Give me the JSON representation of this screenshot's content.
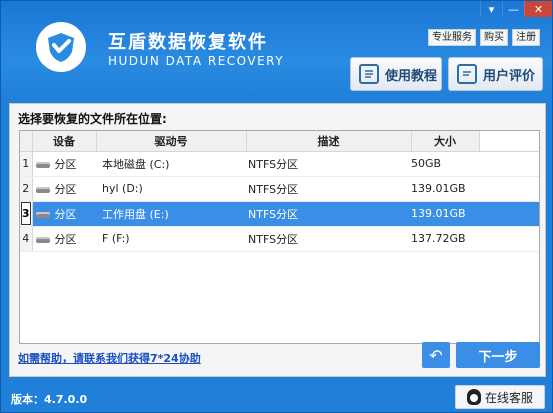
{
  "window": {
    "controls": {
      "minimize": "▾",
      "restore": "—",
      "close": "✕"
    }
  },
  "app": {
    "title": "互盾数据恢复软件",
    "subtitle": "HUDUN DATA RECOVERY",
    "logo_icon": "shield-check-icon",
    "accent": "#1f7bd6"
  },
  "top_links": [
    "专业服务",
    "购买",
    "注册"
  ],
  "buttons": {
    "tutorial": "使用教程",
    "review": "用户评价",
    "next": "下一步",
    "back_icon": "↶"
  },
  "panel": {
    "heading": "选择要恢复的文件所在位置:",
    "columns": [
      "设备",
      "驱动号",
      "描述",
      "大小"
    ],
    "rows": [
      {
        "num": "1",
        "device": "分区",
        "drive": "本地磁盘 (C:)",
        "desc": "NTFS分区",
        "size": "50GB"
      },
      {
        "num": "2",
        "device": "分区",
        "drive": "hyl (D:)",
        "desc": "NTFS分区",
        "size": "139.01GB"
      },
      {
        "num": "3",
        "device": "分区",
        "drive": "工作用盘 (E:)",
        "desc": "NTFS分区",
        "size": "139.01GB"
      },
      {
        "num": "4",
        "device": "分区",
        "drive": "F (F:)",
        "desc": "NTFS分区",
        "size": "137.72GB"
      }
    ],
    "selected_row": 3,
    "help_link": "如需帮助，请联系我们获得7*24协助"
  },
  "footer": {
    "version": "版本：4.7.0.0",
    "service": "在线客服"
  }
}
